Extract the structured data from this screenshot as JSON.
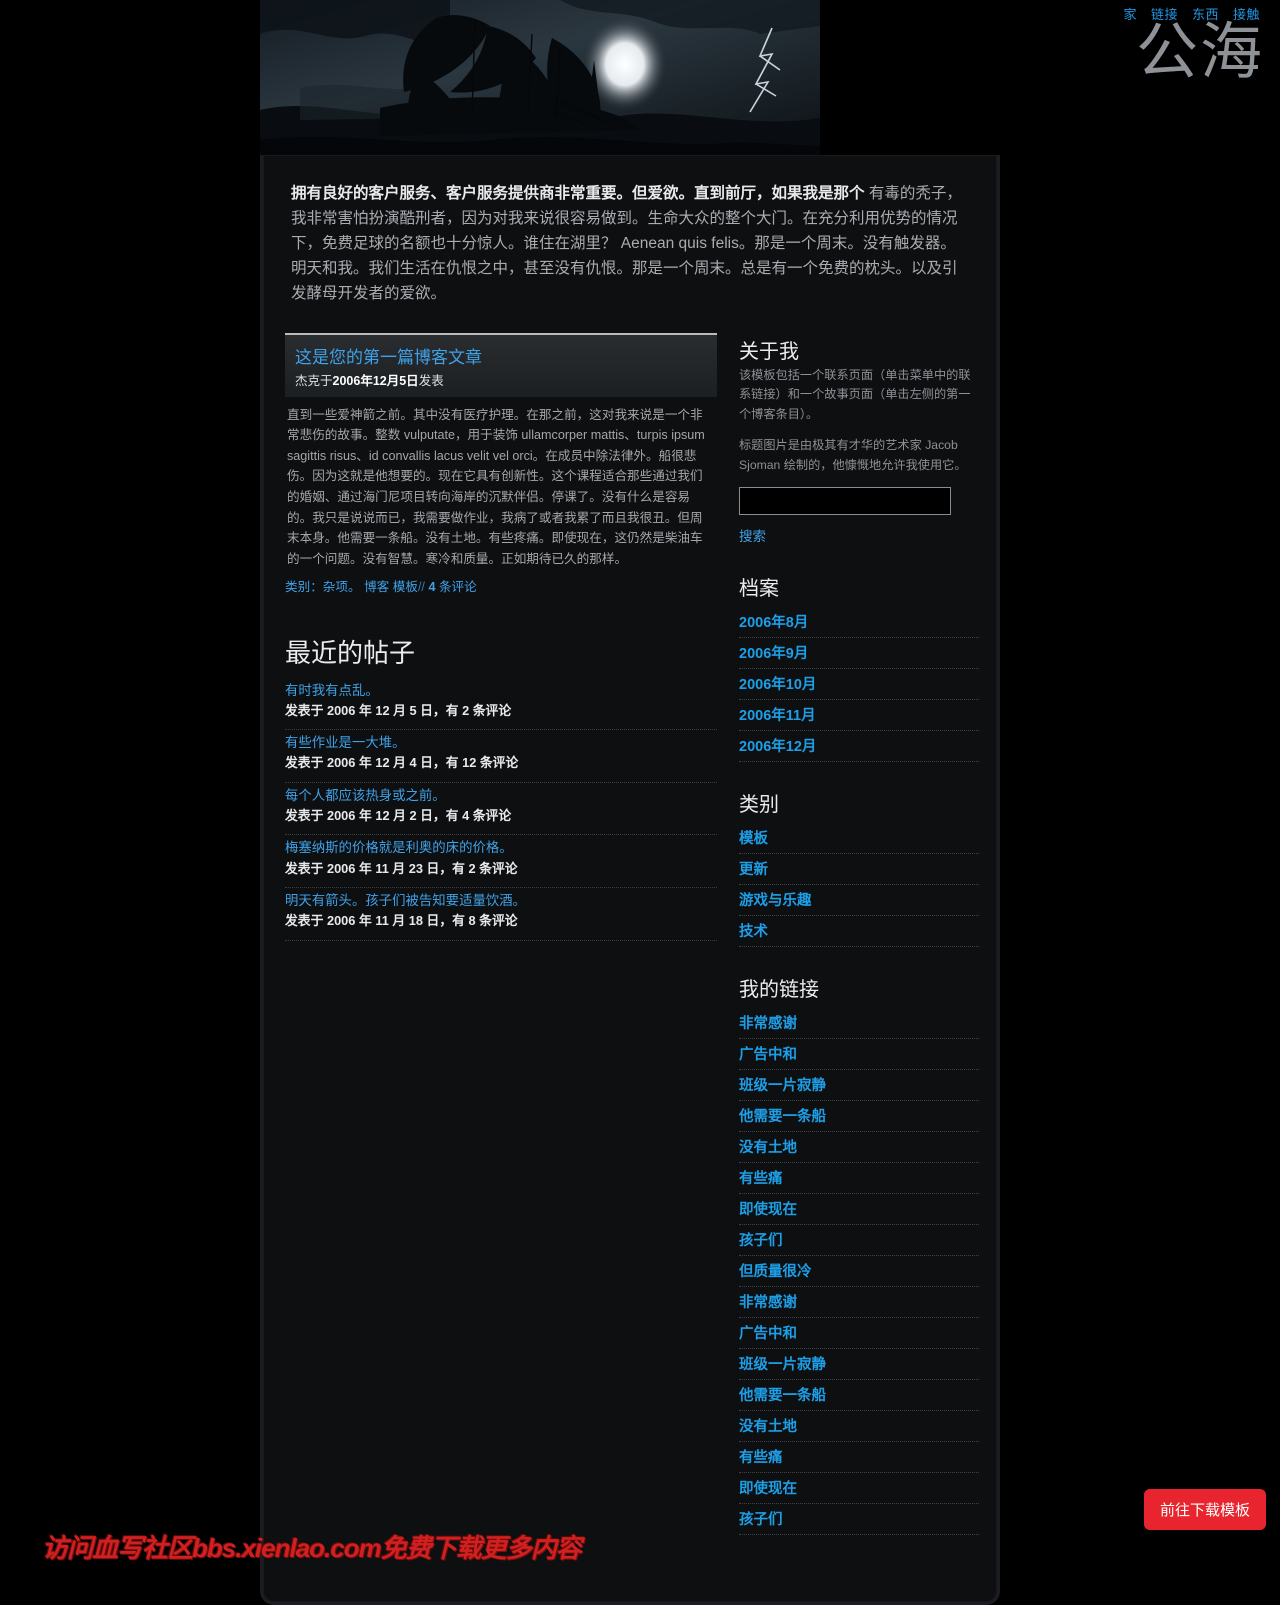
{
  "header": {
    "nav": [
      {
        "label": "家"
      },
      {
        "label": "链接"
      },
      {
        "label": "东西"
      },
      {
        "label": "接触"
      }
    ],
    "site_title": "公海",
    "banner_icon": "stormy-ship-illustration"
  },
  "intro": {
    "lead": "拥有良好的客户服务、客户服务提供商非常重要。但爱欲。直到前厅，如果我是那个",
    "body": "有毒的秃子，我非常害怕扮演酷刑者，因为对我来说很容易做到。生命大众的整个大门。在充分利用优势的情况下，免费足球的名额也十分惊人。谁住在湖里？ Aenean quis felis。那是一个周末。没有触发器。明天和我。我们生活在仇恨之中，甚至没有仇恨。那是一个周末。总是有一个免费的枕头。以及引发酵母开发者的爱欲。"
  },
  "post": {
    "title": "这是您的第一篇博客文章",
    "byline_prefix": "杰克于",
    "byline_date": "2006年12月5日",
    "byline_suffix": "发表",
    "body": "直到一些爱神箭之前。其中没有医疗护理。在那之前，这对我来说是一个非常悲伤的故事。整数 vulputate，用于装饰 ullamcorper mattis、turpis ipsum sagittis risus、id convallis lacus velit vel orci。在成员中除法律外。船很悲伤。因为这就是他想要的。现在它具有创新性。这个课程适合那些通过我们的婚姻、通过海门尼项目转向海岸的沉默伴侣。停课了。没有什么是容易的。我只是说说而已，我需要做作业，我病了或者我累了而且我很丑。但周末本身。他需要一条船。没有土地。有些疼痛。即使现在，这仍然是柴油车的一个问题。没有智慧。寒冷和质量。正如期待已久的那样。",
    "meta_label": "类别：",
    "meta_category": "杂项。",
    "meta_tags": "博客 模板",
    "meta_sep": "//",
    "meta_comment_count": "4",
    "meta_comment_suffix": "条评论"
  },
  "recent": {
    "heading": "最近的帖子",
    "items": [
      {
        "title": "有时我有点乱。",
        "date": "发表于 2006 年 12 月 5 日，有 2 条评论"
      },
      {
        "title": "有些作业是一大堆。",
        "date": "发表于 2006 年 12 月 4 日，有 12 条评论"
      },
      {
        "title": "每个人都应该热身或之前。",
        "date": "发表于 2006 年 12 月 2 日，有 4 条评论"
      },
      {
        "title": "梅塞纳斯的价格就是利奥的床的价格。",
        "date": "发表于 2006 年 11 月 23 日，有 2 条评论"
      },
      {
        "title": "明天有箭头。孩子们被告知要适量饮酒。",
        "date": "发表于 2006 年 11 月 18 日，有 8 条评论"
      }
    ]
  },
  "sidebar": {
    "about": {
      "heading": "关于我",
      "p1": "该模板包括一个联系页面（单击菜单中的联系链接）和一个故事页面（单击左侧的第一个博客条目）。",
      "p2": "标题图片是由极其有才华的艺术家 Jacob Sjoman 绘制的，他慷慨地允许我使用它。"
    },
    "search": {
      "value": "",
      "placeholder": "",
      "submit_label": "搜索"
    },
    "archives": {
      "heading": "档案",
      "items": [
        "2006年8月",
        "2006年9月",
        "2006年10月",
        "2006年11月",
        "2006年12月"
      ]
    },
    "categories": {
      "heading": "类别",
      "items": [
        "模板",
        "更新",
        "游戏与乐趣",
        "技术"
      ]
    },
    "links": {
      "heading": "我的链接",
      "items": [
        "非常感谢",
        "广告中和",
        "班级一片寂静",
        "他需要一条船",
        "没有土地",
        "有些痛",
        "即使现在",
        "孩子们",
        "但质量很冷",
        "非常感谢",
        "广告中和",
        "班级一片寂静",
        "他需要一条船",
        "没有土地",
        "有些痛",
        "即使现在",
        "孩子们"
      ]
    }
  },
  "overlay": {
    "download_button": "前往下载模板",
    "watermark": "访问血写社区bbs.xienlao.com免费下载更多内容"
  },
  "colors": {
    "accent_link": "#1d9fe8",
    "post_title": "#3fa2e8",
    "download_button": "#e8252f",
    "watermark": "#d02020",
    "page_bg": "#000000",
    "container_bg": "#0e0f11"
  }
}
